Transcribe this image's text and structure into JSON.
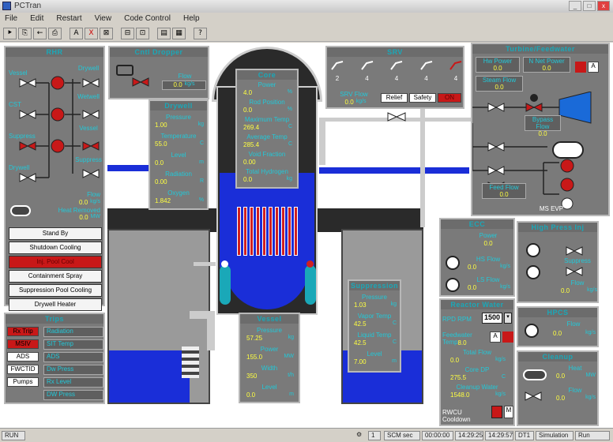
{
  "window": {
    "title": "PCTran"
  },
  "menu": [
    "File",
    "Edit",
    "Restart",
    "View",
    "Code Control",
    "Help"
  ],
  "toolbar": [
    "⯈",
    "⎘",
    "←",
    "⎙",
    "A",
    "X",
    "⊠",
    "⊟",
    "⊡",
    "▤",
    "▦",
    "?"
  ],
  "rhr": {
    "title": "RHR",
    "labels": {
      "vessel": "Vessel",
      "cst": "CST",
      "suppression": "Suppress",
      "drywell": "Drywell",
      "drywell_r": "Drywell",
      "wetwell_r": "Wetwell",
      "vessel_r": "Vessel",
      "suppress_r": "Suppress"
    },
    "flow_label": "Flow",
    "flow_value": "0.0",
    "flow_unit": "kg/s",
    "heat_label": "Heat Removed",
    "heat_value": "0.0",
    "heat_unit": "MW"
  },
  "rhr_modes": [
    "Stand By",
    "Shutdown Cooling",
    "Inj. Pool Cool",
    "Containment Spray",
    "Suppression Pool Cooling",
    "Drywell Heater"
  ],
  "rhr_active_mode": 2,
  "cooling": {
    "title": "Cntl Dropper",
    "flow_label": "Flow",
    "flow_value": "0.0",
    "flow_unit": "kg/s"
  },
  "drywell": {
    "title": "Drywell",
    "rows": [
      {
        "label": "Pressure",
        "value": "1.00",
        "unit": "kg"
      },
      {
        "label": "Temperature",
        "value": "55.0",
        "unit": "C"
      },
      {
        "label": "Level",
        "value": "0.0",
        "unit": "m"
      },
      {
        "label": "Radiation",
        "value": "0.00",
        "unit": "R"
      },
      {
        "label": "Oxygen",
        "value": "1.842",
        "unit": "%"
      }
    ]
  },
  "core": {
    "rows": [
      {
        "label": "Core",
        "value": ""
      },
      {
        "label": "Power",
        "value": "4.0",
        "unit": "%"
      },
      {
        "label": "Rod Position",
        "value": "0.0",
        "unit": "%"
      },
      {
        "label": "Maximum Temp",
        "value": "269.4",
        "unit": "C"
      },
      {
        "label": "Average Temp",
        "value": "285.4",
        "unit": "C"
      },
      {
        "label": "Void Fraction",
        "value": "0.00",
        "unit": ""
      },
      {
        "label": "Total Hydrogen",
        "value": "0.0",
        "unit": "kg"
      }
    ]
  },
  "srv": {
    "title": "SRV",
    "valves": [
      "2",
      "4",
      "4",
      "4",
      "4"
    ],
    "flow_label": "SRV Flow",
    "flow_value": "0.0",
    "flow_unit": "kg/s",
    "buttons": [
      "Relief",
      "Safety"
    ],
    "alarm_label": "ON"
  },
  "turbine": {
    "title": "Turbine/Feedwater",
    "hw_power_label": "Hw Power",
    "hw_power_value": "0.0",
    "net_power_label": "N Net Power",
    "net_power_value": "0.0",
    "steam_flow_label": "Steam Flow",
    "steam_flow_value": "0.0",
    "bypass_label": "Bypass Flow",
    "bypass_value": "0.0",
    "feed_flow_label": "Feed Flow",
    "feed_flow_value": "0.0",
    "mode_a": "A",
    "ms_label": "MS EVP"
  },
  "suppression": {
    "title": "Suppression",
    "rows": [
      {
        "label": "Pressure",
        "value": "1.03",
        "unit": "kg"
      },
      {
        "label": "Vapor Temp",
        "value": "42.5",
        "unit": "C"
      },
      {
        "label": "Liquid Temp",
        "value": "42.5",
        "unit": "C"
      },
      {
        "label": "Level",
        "value": "7.00",
        "unit": "m"
      }
    ]
  },
  "vessel": {
    "title": "Vessel",
    "rows": [
      {
        "label": "Pressure",
        "value": "57.25",
        "unit": "kg"
      },
      {
        "label": "Power",
        "value": "155.0",
        "unit": "MW"
      },
      {
        "label": "Width",
        "value": "350",
        "unit": "t/h"
      },
      {
        "label": "Level",
        "value": "0.0",
        "unit": "m"
      }
    ]
  },
  "ecc": {
    "title": "ECC",
    "rows": [
      {
        "label": "Power",
        "value": "0.0",
        "unit": ""
      },
      {
        "label": "HS Flow",
        "value": "0.0",
        "unit": "kg/s"
      },
      {
        "label": "LS Flow",
        "value": "0.0",
        "unit": "kg/s"
      }
    ]
  },
  "hpci": {
    "title": "High Press Inj",
    "suppress_label": "Suppress",
    "flow_label": "Flow",
    "flow_value": "0.0",
    "flow_unit": "kg/s"
  },
  "reactor_water": {
    "title": "Reactor Water",
    "rpd_label": "RPD RPM",
    "rpd_value": "1500",
    "feedwater_label": "Feedwater Temp",
    "feedwater_value": "8.0",
    "mode_a": "A",
    "total_flow_label": "Total Flow",
    "total_flow_value": "0.0",
    "total_flow_unit": "kg/s",
    "core_dp_label": "Core DP",
    "core_dp_value": "275.5",
    "core_dp_unit": "C",
    "cleanup_label": "Cleanup Water",
    "cleanup_value": "1548.0",
    "cleanup_unit": "kg/s",
    "rwcu_label": "RWCU Cooldown",
    "rwcu_mode": "M"
  },
  "hpcs": {
    "title": "HPCS",
    "flow_label": "Flow",
    "flow_value": "0.0",
    "flow_unit": "kg/s"
  },
  "cleanup_rx": {
    "title": "Cleanup",
    "heat_label": "Heat",
    "heat_value": "0.0",
    "heat_unit": "MW",
    "flow_label": "Flow",
    "flow_value": "0.0",
    "flow_unit": "kg/s"
  },
  "trips": {
    "title": "Trips",
    "items": [
      "Radiation",
      "SIT Temp",
      "ADS",
      "Dw Press",
      "Rx Level",
      "DW Press"
    ],
    "left_buttons": [
      "Rx Trip",
      "MSIV",
      "ADS",
      "FWCTID",
      "Pumps"
    ]
  },
  "status": {
    "mode": "RUN",
    "speed": "1",
    "time": "SCM sec",
    "clock1": "00:00:00",
    "clock2": "14:29:25",
    "clock3": "14:29:57",
    "d1": "DT1",
    "sim": "Simulation",
    "run": "Run"
  }
}
